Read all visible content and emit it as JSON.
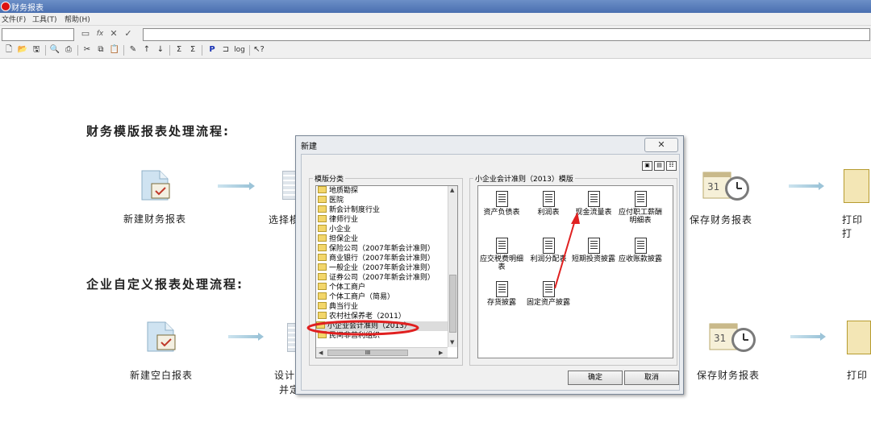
{
  "window": {
    "title": "财务报表"
  },
  "menu": [
    "文件(F)",
    "工具(T)",
    "帮助(H)"
  ],
  "formula_bar": {
    "fx": "fx"
  },
  "workspace": {
    "section1_title": "财务模版报表处理流程:",
    "section2_title": "企业自定义报表处理流程:",
    "flow1": {
      "step1": "新建财务报表",
      "step2": "选择模",
      "step4": "保存财务报表",
      "step5": "打印打"
    },
    "flow2": {
      "step1": "新建空白报表",
      "step2a": "设计",
      "step2b": "并定",
      "step4": "保存财务报表",
      "step5": "打印"
    },
    "calendar_day": "31"
  },
  "dialog": {
    "title": "新建",
    "close": "✕",
    "category_label": "模版分类",
    "template_group_label": "小企业会计准则（2013）模版",
    "categories": [
      "地质勘探",
      "医院",
      "新会计制度行业",
      "律师行业",
      "小企业",
      "担保企业",
      "保险公司（2007年新会计准则）",
      "商业银行（2007年新会计准则）",
      "一般企业（2007年新会计准则）",
      "证券公司（2007年新会计准则）",
      "个体工商户",
      "个体工商户（简易）",
      "典当行业",
      "农村社保养老（2011）",
      "小企业会计准则（2013）",
      "民间非营利组织"
    ],
    "selected_category_index": 14,
    "scrollbar_thumb": "III",
    "templates": [
      "资产负债表",
      "利润表",
      "现金流量表",
      "应付职工薪酬明细表",
      "应交税费明细表",
      "利润分配表",
      "短期投资披露",
      "应收账款披露",
      "存货披露",
      "固定资产披露"
    ],
    "ok_label": "确定",
    "cancel_label": "取消"
  },
  "colors": {
    "annotation": "#e02020",
    "title_bar": "#4a6fb0",
    "selection": "#dcdcdc"
  }
}
